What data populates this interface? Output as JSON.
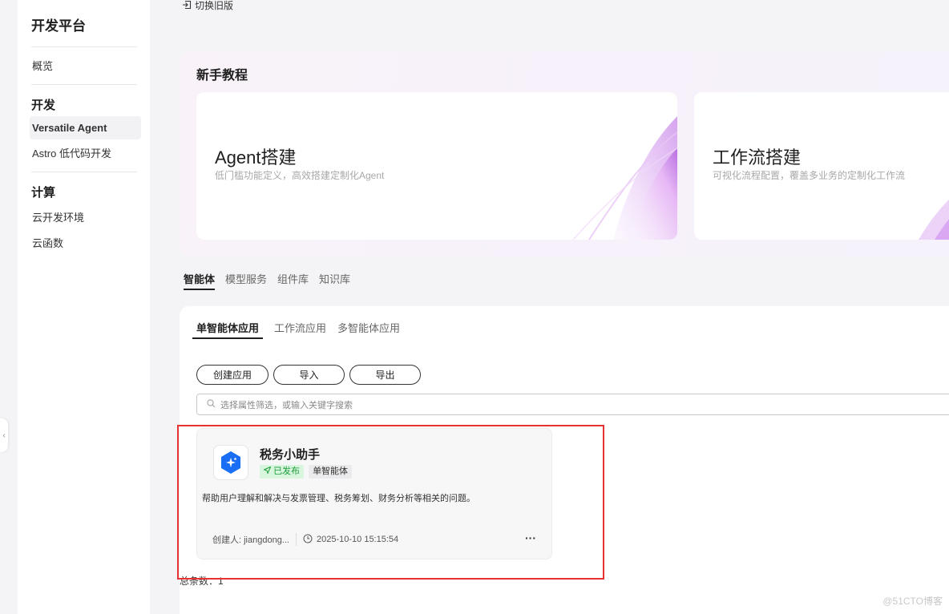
{
  "sidebar": {
    "title": "开发平台",
    "overview": "概览",
    "groups": [
      {
        "title": "开发",
        "items": [
          "Versatile Agent",
          "Astro 低代码开发"
        ]
      },
      {
        "title": "计算",
        "items": [
          "云开发环境",
          "云函数"
        ]
      }
    ]
  },
  "header": {
    "old_version": "切换旧版"
  },
  "tutorial": {
    "title": "新手教程",
    "cards": [
      {
        "title": "Agent搭建",
        "desc": "低门槛功能定义，高效搭建定制化Agent"
      },
      {
        "title": "工作流搭建",
        "desc": "可视化流程配置，覆盖多业务的定制化工作流"
      }
    ]
  },
  "top_tabs": [
    "智能体",
    "模型服务",
    "组件库",
    "知识库"
  ],
  "sub_tabs": [
    "单智能体应用",
    "工作流应用",
    "多智能体应用"
  ],
  "actions": {
    "create": "创建应用",
    "import": "导入",
    "export": "导出"
  },
  "search": {
    "placeholder": "选择属性筛选，或输入关键字搜索"
  },
  "agent": {
    "name": "税务小助手",
    "status": "已发布",
    "type": "单智能体",
    "desc": "帮助用户理解和解决与发票管理、税务筹划、财务分析等相关的问题。",
    "creator": "创建人: jiangdong...",
    "time": "2025-10-10 15:15:54",
    "more": "···"
  },
  "total": "总条数：1",
  "watermark": "@51CTO博客",
  "colors": {
    "accent": "#1f1f1f",
    "published_bg": "#d8f5de",
    "published_text": "#1d9c3a",
    "highlight_box": "#e63232",
    "icon_blue": "#1a6ef5"
  }
}
